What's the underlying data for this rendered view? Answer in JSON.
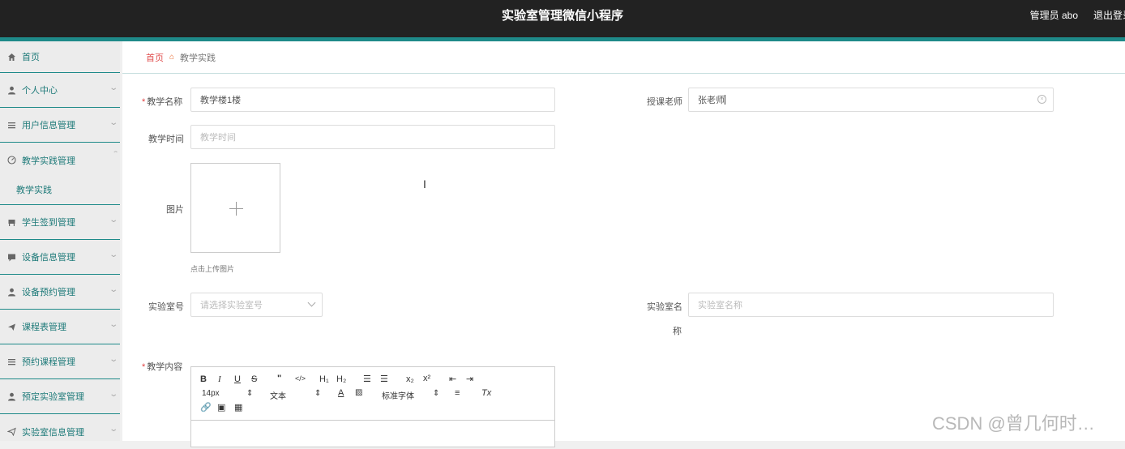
{
  "app": {
    "title": "实验室管理微信小程序"
  },
  "header": {
    "user": "管理员 abo",
    "logout": "退出登录"
  },
  "sidebar": {
    "items": [
      {
        "label": "首页",
        "icon": "home-icon"
      },
      {
        "label": "个人中心",
        "icon": "person-icon"
      },
      {
        "label": "用户信息管理",
        "icon": "list-icon"
      },
      {
        "label": "教学实践管理",
        "icon": "gauge-icon",
        "expanded": true
      },
      {
        "label": "学生签到管理",
        "icon": "chair-icon"
      },
      {
        "label": "设备信息管理",
        "icon": "chat-icon"
      },
      {
        "label": "设备预约管理",
        "icon": "person-icon"
      },
      {
        "label": "课程表管理",
        "icon": "send-icon"
      },
      {
        "label": "预约课程管理",
        "icon": "list-icon"
      },
      {
        "label": "预定实验室管理",
        "icon": "person-icon"
      },
      {
        "label": "实验室信息管理",
        "icon": "send-icon"
      }
    ],
    "sub_item": "教学实践"
  },
  "breadcrumb": {
    "home": "首页",
    "current": "教学实践"
  },
  "form": {
    "teach_name": {
      "label": "教学名称",
      "value": "教学楼1楼"
    },
    "teacher": {
      "label": "授课老师",
      "value": "张老师"
    },
    "teach_time": {
      "label": "教学时间",
      "placeholder": "教学时间"
    },
    "image": {
      "label": "图片",
      "hint": "点击上传图片"
    },
    "lab_no": {
      "label": "实验室号",
      "placeholder": "请选择实验室号"
    },
    "lab_name": {
      "label_line1": "实验室名",
      "label_line2": "称",
      "placeholder": "实验室名称"
    },
    "content": {
      "label": "教学内容"
    }
  },
  "editor": {
    "font_size": "14px",
    "text_type": "文本",
    "font_family": "标准字体"
  },
  "watermark": "CSDN @曾几何时…"
}
